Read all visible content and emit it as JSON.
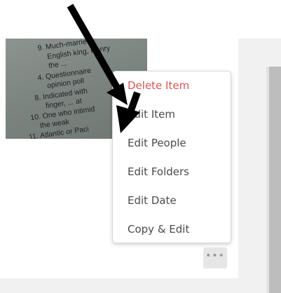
{
  "photo": {
    "lines": [
      "9. Much-married",
      "English king, Henry",
      "the ...",
      "4. Questionnaire",
      "opinion poll",
      "8. Indicated with",
      "finger, ... at",
      "10. One who intimid",
      "the weak",
      "11. Atlantic or Paci"
    ]
  },
  "context_menu": {
    "items": [
      {
        "label": "Delete Item",
        "danger": true
      },
      {
        "label": "Edit Item",
        "danger": false
      },
      {
        "label": "Edit People",
        "danger": false
      },
      {
        "label": "Edit Folders",
        "danger": false
      },
      {
        "label": "Edit Date",
        "danger": false
      },
      {
        "label": "Copy & Edit",
        "danger": false
      }
    ]
  },
  "more_button": {
    "icon": "more-horizontal-icon",
    "glyph": "•••"
  },
  "colors": {
    "danger": "#d9534f",
    "menu_text": "#4a4a4a",
    "arrow": "#000000"
  }
}
